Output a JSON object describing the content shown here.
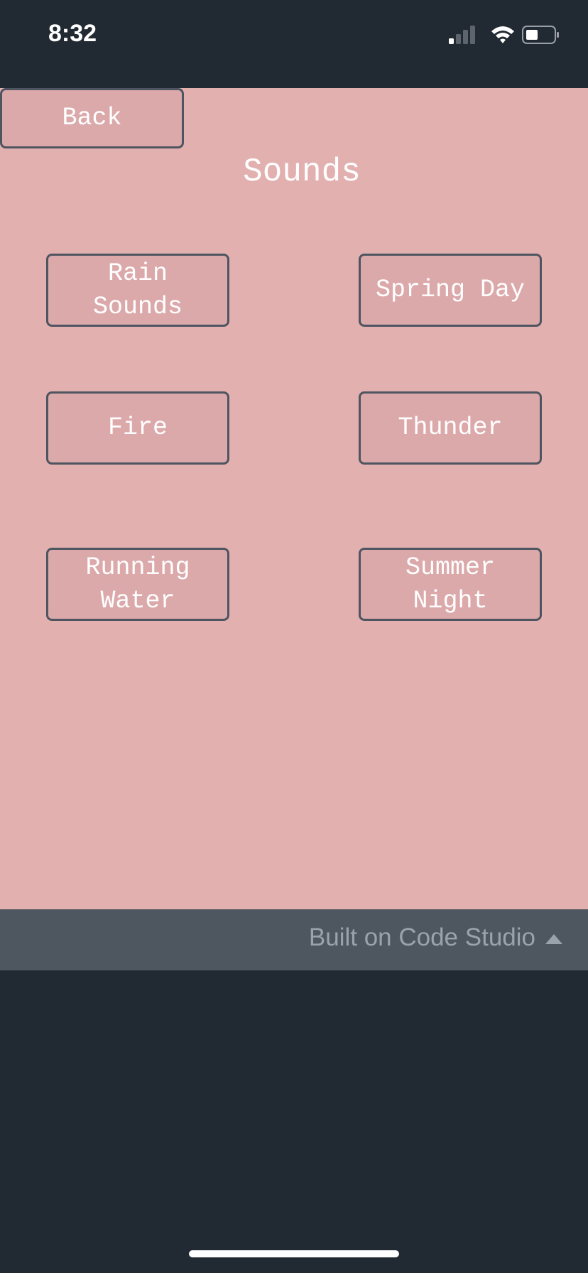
{
  "status_bar": {
    "time": "8:32"
  },
  "screen": {
    "background": "#e3b0b0",
    "back_label": "Back",
    "title": "Sounds",
    "buttons": [
      {
        "label": "Rain\nSounds"
      },
      {
        "label": "Spring Day"
      },
      {
        "label": "Fire"
      },
      {
        "label": "Thunder"
      },
      {
        "label": "Running\nWater"
      },
      {
        "label": "Summer\nNight"
      }
    ]
  },
  "footer": {
    "text": "Built on Code Studio"
  },
  "icons": {
    "signal": "cellular-signal-icon",
    "wifi": "wifi-icon",
    "battery": "battery-icon",
    "caret": "caret-up-icon"
  }
}
